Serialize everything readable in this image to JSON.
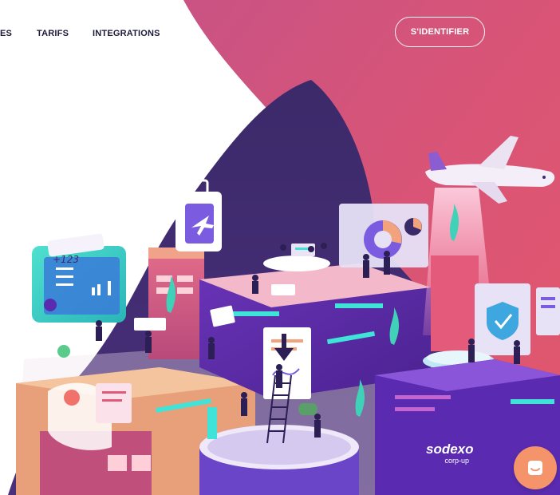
{
  "nav": {
    "items": [
      {
        "label": "ES"
      },
      {
        "label": "TARIFS"
      },
      {
        "label": "INTEGRATIONS"
      }
    ],
    "login_label": "S'IDENTIFIER"
  },
  "illustration": {
    "ticket_text": "+123",
    "brand_name": "sodexo",
    "brand_sub": "corp-up"
  },
  "icons": [
    "plane-icon",
    "chat-icon",
    "phone-off-icon",
    "arrow-down-icon",
    "shield-check-icon",
    "pie-chart-icon"
  ],
  "colors": {
    "bg_pink": "#d95476",
    "bg_deep_purple": "#2b1f55",
    "accent_cyan": "#3fe3d8",
    "chat_orange": "#f5936a",
    "nav_text": "#1c1a3a"
  }
}
